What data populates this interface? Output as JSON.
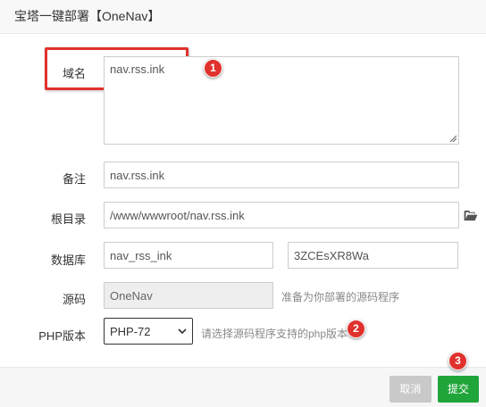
{
  "dialog": {
    "title": "宝塔一键部署【OneNav】"
  },
  "form": {
    "domain": {
      "label": "域名",
      "value": "nav.rss.ink"
    },
    "remark": {
      "label": "备注",
      "value": "nav.rss.ink"
    },
    "root": {
      "label": "根目录",
      "value": "/www/wwwroot/nav.rss.ink"
    },
    "database": {
      "label": "数据库",
      "name": "nav_rss_ink",
      "password": "3ZCEsXR8Wa"
    },
    "source": {
      "label": "源码",
      "value": "OneNav",
      "hint": "准备为你部署的源码程序"
    },
    "php": {
      "label": "PHP版本",
      "selected": "PHP-72",
      "hint": "请选择源码程序支持的php版本"
    }
  },
  "annotations": {
    "badge1": "1",
    "badge2": "2",
    "badge3": "3"
  },
  "footer": {
    "cancel_label": "取消",
    "submit_label": "提交"
  },
  "colors": {
    "submit": "#20a53a",
    "cancel": "#c9c9c9",
    "annotation": "#e0312d"
  },
  "icons": {
    "folder": "folder-open-icon",
    "select_arrow": "chevron-down-icon"
  }
}
